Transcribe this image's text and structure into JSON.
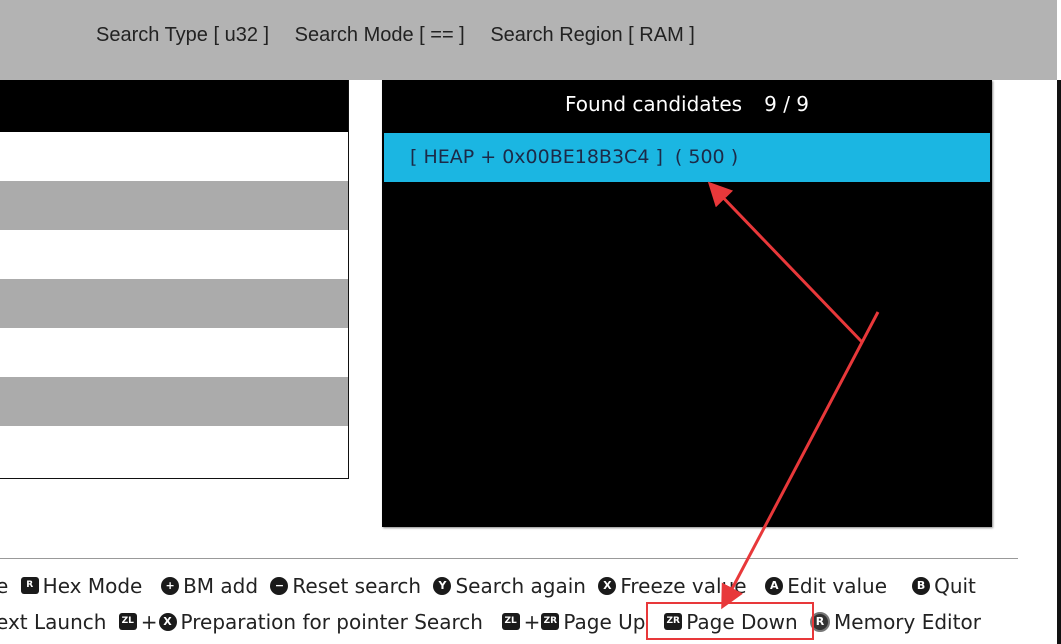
{
  "topbar": {
    "search_type": "Search Type [ u32 ]",
    "search_mode": "Search Mode [ == ]",
    "search_region": "Search Region [ RAM ]"
  },
  "results": {
    "found_label": "Found candidates",
    "found_count": "9 / 9",
    "selected_item": "[ HEAP + 0x00BE18B3C4 ]  ( 500 )",
    "highlight_color": "#1bb6e2"
  },
  "hints": {
    "line1": [
      {
        "icon": "",
        "label": "e"
      },
      {
        "icon": "R",
        "shape": "square",
        "label": "Hex Mode"
      },
      {
        "icon": "+",
        "shape": "circle",
        "label": "BM add"
      },
      {
        "icon": "−",
        "shape": "circle",
        "label": "Reset search"
      },
      {
        "icon": "Y",
        "shape": "circle",
        "label": "Search again"
      },
      {
        "icon": "X",
        "shape": "circle",
        "label": "Freeze value"
      },
      {
        "icon": "A",
        "shape": "circle",
        "label": "Edit value"
      },
      {
        "icon": "B",
        "shape": "circle",
        "label": "Quit"
      }
    ],
    "line2_prefix": "ext Launch",
    "zl": "ZL",
    "zr": "ZR",
    "x": "X",
    "rstick": "R",
    "plus": "+",
    "pointer_search": "Preparation for pointer Search",
    "page_up": "Page Up",
    "page_down": "Page Down",
    "memory_editor": "Memory Editor"
  },
  "annotation_color": "#e8383a"
}
